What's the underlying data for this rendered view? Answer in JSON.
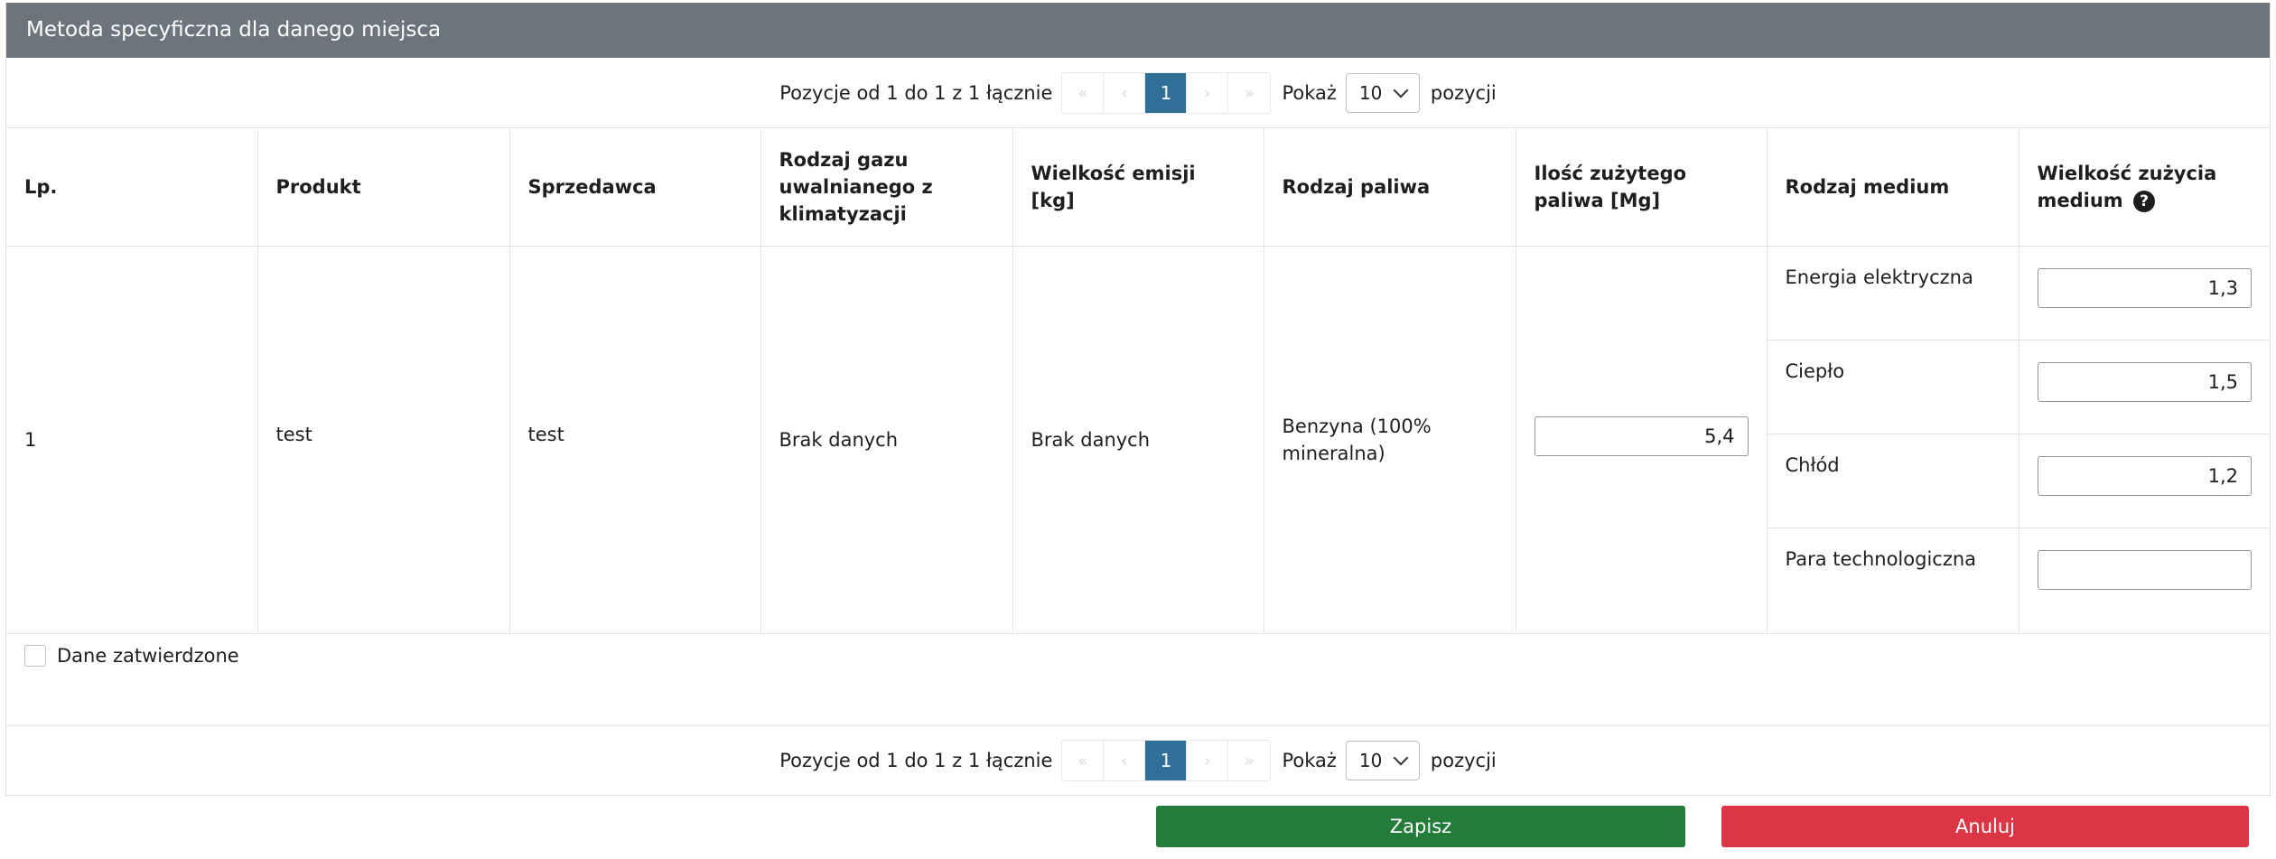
{
  "panel": {
    "title": "Metoda specyficzna dla danego miejsca"
  },
  "pager": {
    "summary": "Pozycje od 1 do 1 z 1 łącznie",
    "nav": {
      "first": "«",
      "prev": "‹",
      "current": "1",
      "next": "›",
      "last": "»"
    },
    "show_label": "Pokaż",
    "per_page": "10",
    "items_label": "pozycji"
  },
  "table": {
    "headers": [
      "Lp.",
      "Produkt",
      "Sprzedawca",
      "Rodzaj gazu uwalnianego z klimatyzacji",
      "Wielkość emisji [kg]",
      "Rodzaj paliwa",
      "Ilość zużytego paliwa [Mg]",
      "Rodzaj medium",
      "Wielkość zużycia medium"
    ],
    "help_icon": "question-circle-icon",
    "row": {
      "lp": "1",
      "product": "test",
      "seller": "test",
      "gas_type": "Brak danych",
      "emission": "Brak danych",
      "fuel_type": "Benzyna (100% mineralna)",
      "fuel_amount": "5,4",
      "media": [
        {
          "name": "Energia elektryczna",
          "value": "1,3"
        },
        {
          "name": "Ciepło",
          "value": "1,5"
        },
        {
          "name": "Chłód",
          "value": "1,2"
        },
        {
          "name": "Para technologiczna",
          "value": ""
        }
      ]
    }
  },
  "approved_label": "Dane zatwierdzone",
  "buttons": {
    "save": "Zapisz",
    "cancel": "Anuluj"
  },
  "colors": {
    "header_bg": "#6c757d",
    "page_active": "#2f6f98",
    "save": "#237c3a",
    "cancel": "#dc3545"
  }
}
